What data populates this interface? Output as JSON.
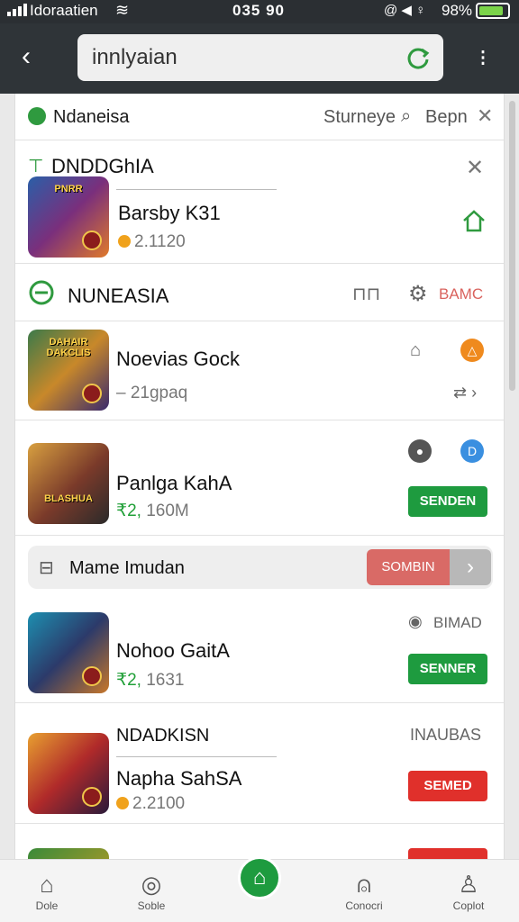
{
  "status_bar": {
    "carrier": "Idoraatien",
    "time": "035 90",
    "icons": "@ ◀ ♀",
    "battery": "98%"
  },
  "header": {
    "search_value": "innlyaian"
  },
  "panel": {
    "top_bar": {
      "left_label": "Ndaneisa",
      "right_label_1": "Sturneye",
      "right_label_2": "Bepn"
    },
    "section1": {
      "title": "DNDDGhIA",
      "item": {
        "name": "Barsby K31",
        "sub": "2.1120",
        "thumb_caption": "PNRR"
      }
    },
    "section2": {
      "title": "NUNEASIA",
      "action_label": "BAMC",
      "items": [
        {
          "name": "Noevias Gock",
          "sub": "– 21gpaq",
          "thumb_caption": "DAHAIR DAKCLIS"
        },
        {
          "name": "Panlga KahA",
          "price": "₹2,",
          "sub": "160M",
          "thumb_caption": "BLASHUA",
          "button": "SENDEN"
        }
      ]
    },
    "banner": {
      "text": "Mame Imudan",
      "button": "SOMBIN"
    },
    "section3": {
      "items": [
        {
          "name": "Nohoo GaitA",
          "price": "₹2,",
          "sub": "1631",
          "side_label": "BIMAD",
          "button": "SENNER"
        },
        {
          "title": "NDADKISN",
          "name": "Napha SahSA",
          "sub": "2.2100",
          "side_label": "INAUBAS",
          "button": "SEMED"
        }
      ]
    }
  },
  "bottom_nav": {
    "items": [
      {
        "label": "Dole",
        "icon": "home-outline-icon"
      },
      {
        "label": "Soble",
        "icon": "compass-icon"
      },
      {
        "label": "",
        "icon": "home-icon"
      },
      {
        "label": "Conocri",
        "icon": "person-icon"
      },
      {
        "label": "Coplot",
        "icon": "profile-icon"
      }
    ]
  },
  "colors": {
    "accent_green": "#1e9b3f",
    "accent_red": "#e0302b",
    "header_bg": "#2f3438"
  }
}
